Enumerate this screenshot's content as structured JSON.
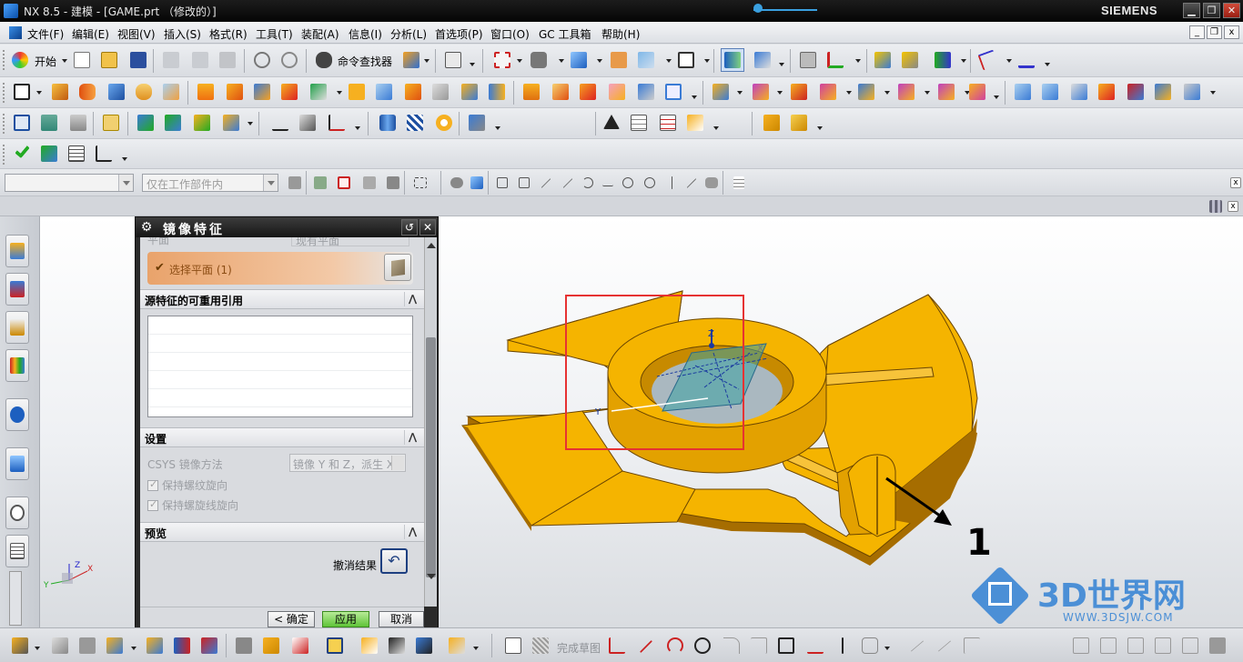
{
  "window": {
    "title": "NX 8.5 - 建模 - [GAME.prt （修改的）]",
    "brand": "SIEMENS",
    "minimize": "▁",
    "restore": "❐",
    "close": "✕"
  },
  "menu": {
    "items": [
      "文件(F)",
      "编辑(E)",
      "视图(V)",
      "插入(S)",
      "格式(R)",
      "工具(T)",
      "装配(A)",
      "信息(I)",
      "分析(L)",
      "首选项(P)",
      "窗口(O)",
      "GC 工具箱",
      "帮助(H)"
    ]
  },
  "toolbar": {
    "start_label": "开始",
    "command_finder_label": "命令查找器"
  },
  "selection_bar": {
    "filter_value": "",
    "scope_value": "仅在工作部件内"
  },
  "dialog": {
    "title": "镜像特征",
    "plane_faded_label": "平面",
    "plane_faded_value": "现有平面",
    "select_plane_label": "选择平面 (1)",
    "reuse_section": "源特征的可重用引用",
    "settings_section": "设置",
    "csys_label": "CSYS 镜像方法",
    "csys_value": "镜像 Y 和 Z，派生 X",
    "keep_thread_label": "保持螺纹旋向",
    "keep_helix_label": "保持螺旋线旋向",
    "preview_section": "预览",
    "undo_result_label": "撤消结果",
    "ok_label": "< 确定 >",
    "apply_label": "应用",
    "cancel_label": "取消"
  },
  "statusbar": {
    "finish_sketch_label": "完成草图"
  },
  "viewport": {
    "axis_x": "X",
    "axis_y": "Y",
    "axis_z": "Z",
    "annotation": "1",
    "triad_x": "X",
    "triad_y": "Y",
    "triad_z": "Z",
    "model_color": "#f5b400",
    "highlight_color": "#e63232"
  },
  "watermark": {
    "title": "3D世界网",
    "url": "WWW.3DSJW.COM"
  }
}
